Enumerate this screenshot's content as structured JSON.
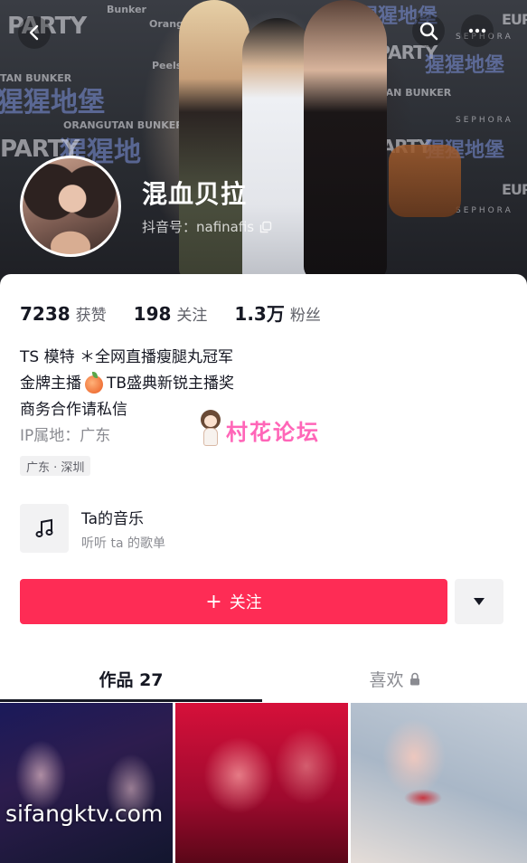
{
  "banner": {
    "wall_text": {
      "party_1": "PARTY",
      "bunker": "Bunker",
      "orang": "Orang",
      "peels": "Peels",
      "tan_bunker": "TAN BUNKER",
      "cn_1": "猩猩地堡",
      "orangutan_bunker": "ORANGUTAN BUNKER",
      "cn_2": "猩猩地",
      "party_2": "PARTY",
      "ria_party": "RIA PARTY",
      "cn_3": "猩猩地堡",
      "sephora": "SEPHORA",
      "tan_bunker_2": "TAN BUNKER",
      "cn_4": "猩猩地堡",
      "sephora_2": "SEPHORA",
      "party_3": "PARTY",
      "cn_5": "猩猩地堡",
      "sephora_3": "SEPHORA",
      "eup": "EUP",
      "eupl": "EUPI"
    }
  },
  "profile": {
    "nickname": "混血贝拉",
    "douyin_id": "抖音号：nafinafis"
  },
  "stats": [
    {
      "value": "7238",
      "label": "获赞"
    },
    {
      "value": "198",
      "label": "关注"
    },
    {
      "value": "1.3万",
      "label": "粉丝"
    }
  ],
  "bio": {
    "line1": "TS 模特 ＊全网直播瘦腿丸冠军",
    "line2_a": "金牌主播",
    "line2_b": "TB盛典新锐主播奖",
    "line3": "商务合作请私信",
    "ip": "IP属地：广东",
    "location_tag": "广东 · 深圳"
  },
  "watermark": {
    "text": "村花论坛"
  },
  "music": {
    "title": "Ta的音乐",
    "subtitle": "听听 ta 的歌单"
  },
  "actions": {
    "follow_label": "关注",
    "follow_prefix": "+"
  },
  "tabs": {
    "works": "作品 27",
    "likes": "喜欢"
  },
  "thumbnails": {
    "watermark": "sifangktv.com"
  },
  "icons": {
    "back": "back-icon",
    "search": "search-icon",
    "more": "more-icon",
    "copy": "copy-icon",
    "music": "music-note-icon",
    "dropdown": "caret-down-icon",
    "lock": "lock-icon"
  },
  "colors": {
    "accent": "#fe2c55",
    "text_primary": "#161823",
    "text_secondary": "#8a8b91",
    "watermark": "#ff66b8"
  }
}
